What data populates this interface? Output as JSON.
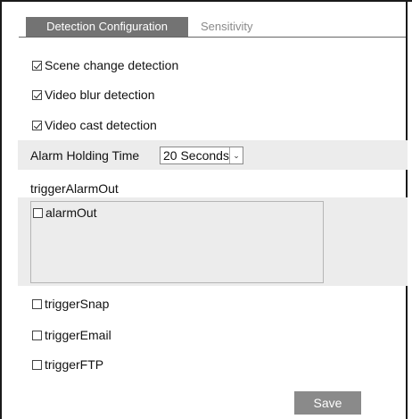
{
  "tabs": [
    {
      "label": "Detection Configuration",
      "active": true
    },
    {
      "label": "Sensitivity",
      "active": false
    }
  ],
  "detections": [
    {
      "label": "Scene change detection",
      "checked": true
    },
    {
      "label": "Video blur detection",
      "checked": true
    },
    {
      "label": "Video cast detection",
      "checked": true
    }
  ],
  "alarm_holding": {
    "label": "Alarm Holding Time",
    "value": "20 Seconds"
  },
  "trigger_alarm_out": {
    "label": "triggerAlarmOut",
    "items": [
      {
        "label": "alarmOut",
        "checked": false
      }
    ]
  },
  "triggers": [
    {
      "label": "triggerSnap",
      "checked": false
    },
    {
      "label": "triggerEmail",
      "checked": false
    },
    {
      "label": "triggerFTP",
      "checked": false
    }
  ],
  "save_label": "Save",
  "colors": {
    "active_tab_bg": "#737373",
    "inactive_tab_text": "#8a8a8a",
    "band_bg": "#ececec",
    "save_bg": "#8a8a8a"
  }
}
